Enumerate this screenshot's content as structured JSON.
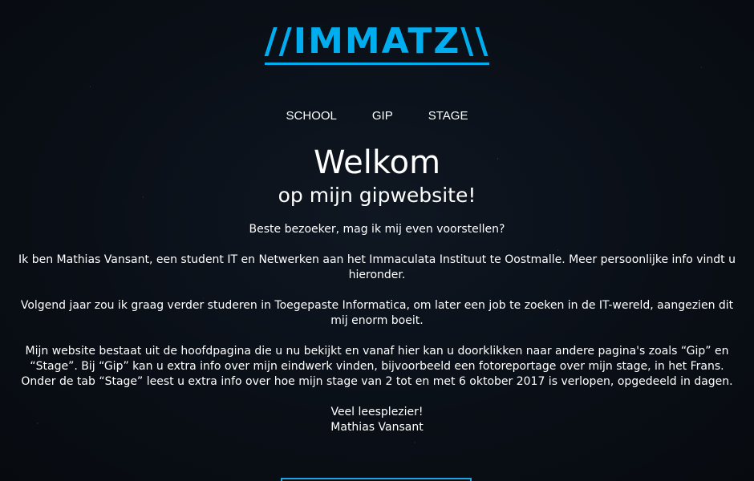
{
  "header": {
    "logo_text": "//IMMATZ\\\\"
  },
  "nav": {
    "items": [
      {
        "label": "SCHOOL"
      },
      {
        "label": "GIP"
      },
      {
        "label": "STAGE"
      }
    ]
  },
  "hero": {
    "title": "Welkom",
    "subtitle": "op mijn gipwebsite!"
  },
  "intro": {
    "p1": "Beste bezoeker, mag ik mij even voorstellen?",
    "p2": "Ik ben Mathias Vansant, een student IT en Netwerken aan het Immaculata Instituut te Oostmalle. Meer persoonlijke info vindt u hieronder.",
    "p3": "Volgend jaar zou ik graag verder studeren in Toegepaste Informatica, om later een job te zoeken in de IT-wereld, aangezien dit mij enorm boeit.",
    "p4": "Mijn website bestaat uit de hoofdpagina die u nu bekijkt en vanaf hier kan u doorklikken naar andere pagina's zoals “Gip” en “Stage”. Bij “Gip” kan u extra info over mijn eindwerk vinden, bijvoorbeeld een fotoreportage over mijn stage, in het Frans. Onder de tab “Stage” leest u extra info over hoe mijn stage van 2 tot en met 6 oktober 2017 is verlopen, opgedeeld in dagen.",
    "closing_line1": "Veel leesplezier!",
    "closing_line2": "Mathias Vansant"
  },
  "colors": {
    "accent": "#00aef0",
    "background": "#0a0f17",
    "text": "#ffffff"
  }
}
